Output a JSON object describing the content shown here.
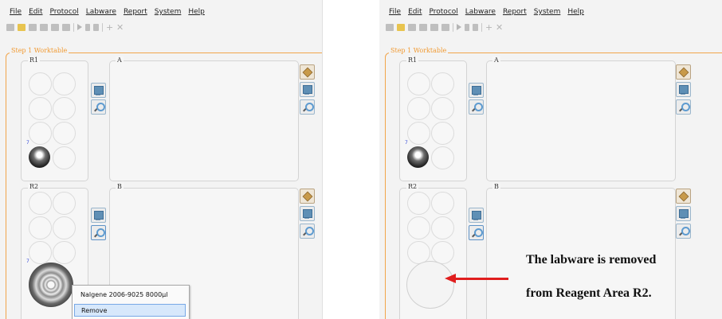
{
  "menu": [
    "File",
    "Edit",
    "Protocol",
    "Labware",
    "Report",
    "System",
    "Help"
  ],
  "section_title": "Step 1 Worktable",
  "areas": {
    "r1": "R1",
    "a": "A",
    "r2": "R2",
    "b": "B"
  },
  "well_number": "7",
  "context_menu": {
    "item1": "Nalgene 2006-9025 8000µl",
    "item2": "Remove"
  },
  "annotation": {
    "line1": "The labware is removed",
    "line2": "from Reagent Area R2."
  },
  "colors": {
    "step_frame": "#f1a54a",
    "arrow": "#e01e1e",
    "highlight": "#d7e8fb"
  }
}
